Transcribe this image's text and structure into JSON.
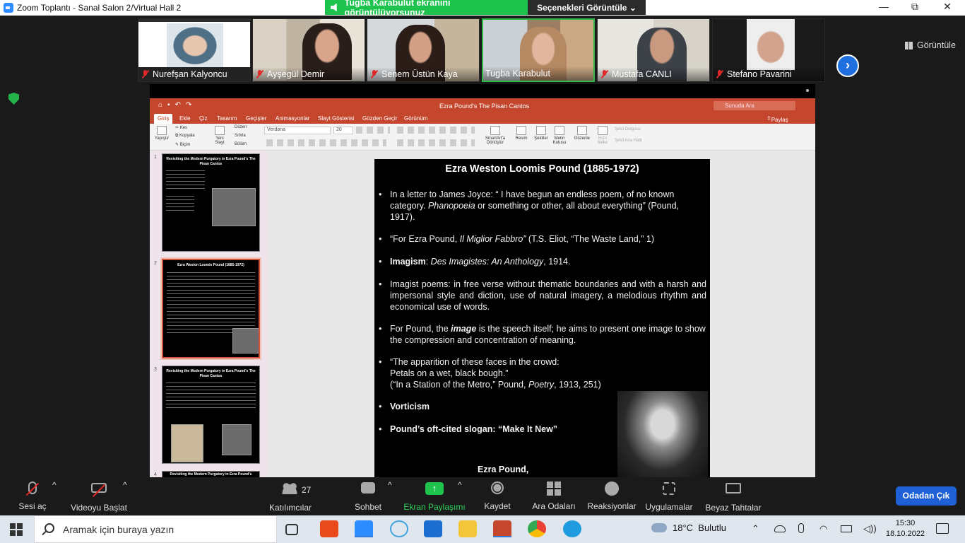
{
  "window": {
    "title": "Zoom Toplantı - Sanal Salon 2/Virtual Hall 2"
  },
  "share_banner": {
    "text": "Tugba Karabulut ekranını görüntülüyorsunuz",
    "view_options": "Seçenekleri Görüntüle"
  },
  "window_controls": {
    "minimize": "—",
    "maximize": "⧉",
    "close": "✕"
  },
  "participants": [
    {
      "name": "Nurefşan Kalyoncu",
      "muted": true
    },
    {
      "name": "Ayşegül Demir",
      "muted": true
    },
    {
      "name": "Senem Üstün Kaya",
      "muted": true
    },
    {
      "name": "Tugba Karabulut",
      "muted": false,
      "speaking": true
    },
    {
      "name": "Mustafa CANLI",
      "muted": true
    },
    {
      "name": "Stefano Pavarini",
      "muted": true
    }
  ],
  "gallery": {
    "view_label": "Görüntüle",
    "next_icon": "chevron-right-icon"
  },
  "powerpoint": {
    "doc_title": "Ezra Pound's The Pisan Cantos",
    "search_placeholder": "Sunuda Ara",
    "share_label": "Paylaş",
    "tabs": [
      "Giriş",
      "Ekle",
      "Çiz",
      "Tasarım",
      "Geçişler",
      "Animasyonlar",
      "Slayt Gösterisi",
      "Gözden Geçir",
      "Görünüm"
    ],
    "ribbon": {
      "paste": "Yapıştır",
      "cut": "Kes",
      "copy": "Kopyala",
      "format": "Biçim",
      "new_slide": "Yeni Slayt",
      "layout": "Düzen",
      "reset": "Sıfırla",
      "section": "Bölüm",
      "font": "Verdana",
      "size": "20",
      "smartart": "SmartArt'a Dönüştür",
      "picture": "Resim",
      "shapes": "Şekiller",
      "textbox": "Metin Kutusu",
      "arrange": "Düzenle",
      "quick_styles": "Hızlı Stiller",
      "shape_fill": "Şekil Dolgusu",
      "shape_outline": "Şekil Ana Hattı"
    },
    "thumbnails": [
      {
        "num": "1",
        "title": "Revisiting the Modern Purgatory in Ezra Pound's The Pisan Cantos"
      },
      {
        "num": "2",
        "title": "Ezra Weston Loomis Pound (1885-1972)"
      },
      {
        "num": "3",
        "title": "Revisiting the Modern Purgatory in Ezra Pound's The Pisan Cantos"
      },
      {
        "num": "4",
        "title": "Revisiting the Modern Purgatory in Ezra Pound's"
      }
    ]
  },
  "slide": {
    "title": "Ezra Weston Loomis Pound (1885-1972)",
    "bullets": [
      {
        "pre": "In a letter to James Joyce: “ I have begun an endless poem, of no known category. ",
        "em": "Phanopoeia",
        "post": " or something or other, all about everything” (Pound, 1917)."
      },
      {
        "pre": "“For Ezra Pound, ",
        "em": "Il Miglior Fabbro”",
        "post": " (T.S. Eliot, “The Waste Land,” 1)"
      },
      {
        "strong": "Imagism",
        "pre": ": ",
        "em": "Des Imagistes: An Anthology",
        "post": ", 1914."
      },
      {
        "pre": "Imagist poems: in free verse without thematic boundaries and with a harsh and impersonal style and diction, use of natural imagery, a melodious rhythm and economical use of words."
      },
      {
        "pre": "For Pound, the ",
        "em": "image",
        "post": " is the speech itself; he aims to present one image to show the compression and concentration of meaning."
      },
      {
        "pre": "“The apparition of these faces in the crowd:\nPetals on a wet, black bough.”\n(“In a Station of the Metro,” Pound, ",
        "em": "Poetry",
        "post": ", 1913, 251)"
      },
      {
        "strong": "Vorticism"
      },
      {
        "strong": "Pound’s oft-cited slogan: “Make It New”"
      }
    ],
    "caption": "Ezra Pound,"
  },
  "toolbar": {
    "mute": "Sesi aç",
    "video": "Videoyu Başlat",
    "participants": "Katılımcılar",
    "participant_count": "27",
    "chat": "Sohbet",
    "share": "Ekran Paylaşımı",
    "record": "Kaydet",
    "rooms": "Ara Odaları",
    "reactions": "Reaksiyonlar",
    "apps": "Uygulamalar",
    "whiteboard": "Beyaz Tahtalar",
    "leave": "Odadan Çık"
  },
  "taskbar": {
    "search_placeholder": "Aramak için buraya yazın",
    "weather_temp": "18°C",
    "weather_text": "Bulutlu",
    "time": "15:30",
    "date": "18.10.2022",
    "app_icons": [
      "task-view-icon",
      "office-icon",
      "zoom-icon",
      "snipping-icon",
      "mail-icon",
      "file-explorer-icon",
      "powerpoint-icon",
      "chrome-icon",
      "edge-icon"
    ],
    "colors": {
      "zoom": "#2d8cff",
      "office": "#e84a1c",
      "mail": "#1c6fd1",
      "explorer": "#f3c63b",
      "ppt": "#c4462d",
      "edge": "#1f9be0"
    }
  },
  "colors": {
    "share_green": "#1ec34d",
    "ppt_red": "#c4462d",
    "leave_blue": "#1f60d6",
    "mute_red": "#e02828"
  }
}
